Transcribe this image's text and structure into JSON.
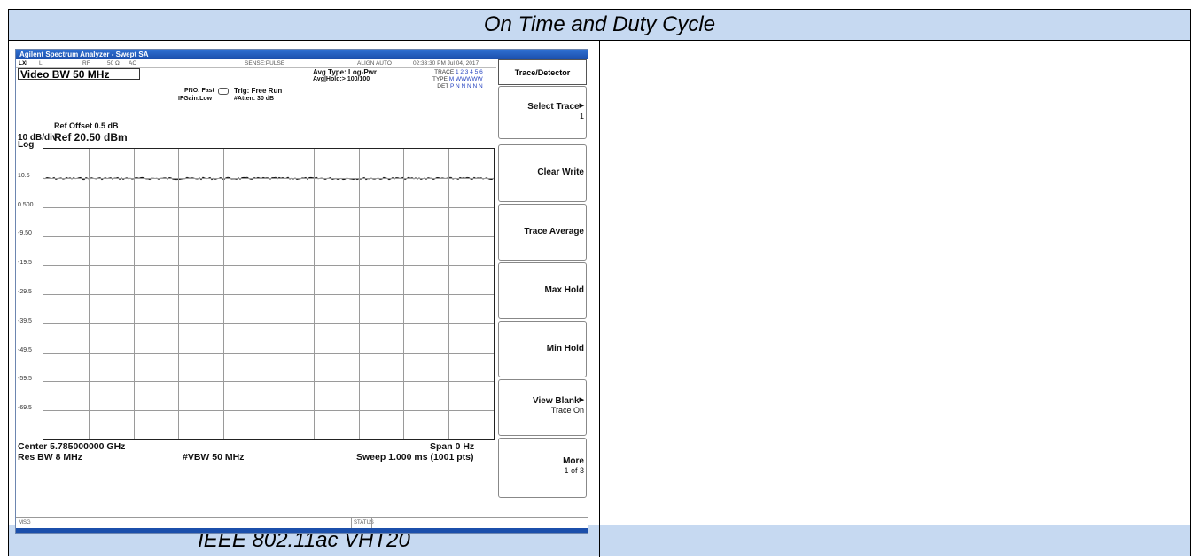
{
  "table": {
    "title": "On Time and Duty Cycle",
    "footer_left": "IEEE 802.11ac VHT20",
    "footer_right": ""
  },
  "analyzer": {
    "window_title": "Agilent Spectrum Analyzer - Swept SA",
    "status": {
      "lxi": "LXI",
      "l": "L",
      "rf": "RF",
      "impedance": "50 Ω",
      "coupling": "AC",
      "sense": "SENSE:PULSE",
      "align": "ALIGN AUTO",
      "timestamp": "02:33:30 PM Jul 04, 2017"
    },
    "header_label": "Video BW 50 MHz",
    "pno": "PNO: Fast",
    "ifgain": "IFGain:Low",
    "trig": "Trig: Free Run",
    "atten": "#Atten: 30 dB",
    "avg_type": "Avg Type: Log-Pwr",
    "avg_hold": "Avg|Hold:> 100/100",
    "trace_row": "TRACE",
    "trace_nums": "1 2 3 4 5 6",
    "type_row": "TYPE",
    "type_vals": "M WWWWW",
    "det_row": "DET",
    "det_vals": "P N N N N N",
    "ref_offset": "Ref Offset 0.5 dB",
    "scale": "10 dB/div",
    "ref_level": "Ref 20.50 dBm",
    "log": "Log",
    "y_ticks": [
      "10.5",
      "0.500",
      "-9.50",
      "-19.5",
      "-29.5",
      "-39.5",
      "-49.5",
      "-59.5",
      "-69.5"
    ],
    "center": "Center 5.785000000 GHz",
    "span": "Span 0 Hz",
    "res_bw": "Res BW 8 MHz",
    "vbw": "#VBW 50 MHz",
    "sweep": "Sweep  1.000 ms (1001 pts)",
    "msg": "MSG",
    "status_label": "STATUS",
    "trace_level_db": 10.3,
    "softkeys": {
      "title": "Trace/Detector",
      "items": [
        {
          "label": "Select Trace",
          "sub": "1"
        },
        {
          "label": "Clear Write",
          "sub": ""
        },
        {
          "label": "Trace Average",
          "sub": ""
        },
        {
          "label": "Max Hold",
          "sub": ""
        },
        {
          "label": "Min Hold",
          "sub": ""
        },
        {
          "label": "View Blank",
          "sub": "Trace On"
        },
        {
          "label": "More",
          "sub": "1 of 3"
        }
      ]
    }
  }
}
